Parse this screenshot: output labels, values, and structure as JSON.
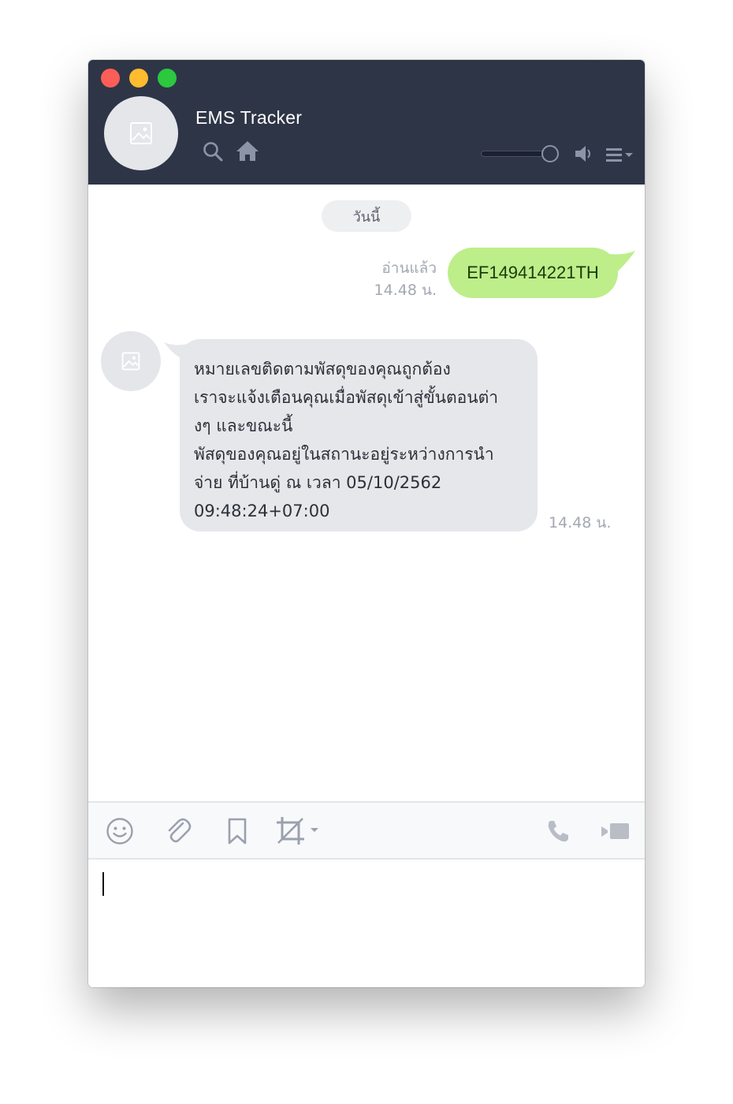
{
  "window": {
    "controls": [
      "close",
      "minimize",
      "zoom"
    ]
  },
  "header": {
    "title": "EMS Tracker",
    "avatar_icon": "image-placeholder-icon",
    "icons": [
      "search-icon",
      "home-icon",
      "speaker-icon",
      "menu-icon"
    ],
    "volume_level": 0.9,
    "colors": {
      "background": "#2e3547",
      "title": "#ffffff"
    }
  },
  "chat": {
    "date_separator": "วันนี้",
    "messages": [
      {
        "direction": "sent",
        "text": "EF149414221TH",
        "status": "อ่านแล้ว",
        "time": "14.48 น.",
        "bubble_color": "#bdee8a"
      },
      {
        "direction": "received",
        "lines": [
          "หมายเลขติดตามพัสดุของคุณถูกต้อง",
          "เราจะแจ้งเตือนคุณเมื่อพัสดุเข้าสู่ขั้นตอนต่า",
          "งๆ และขณะนี้",
          "พัสดุของคุณอยู่ในสถานะอยู่ระหว่างการนำ",
          "จ่าย ที่บ้านดู่ ณ เวลา 05/10/2562",
          "09:48:24+07:00"
        ],
        "time": "14.48 น.",
        "bubble_color": "#e5e7ea",
        "avatar_icon": "image-placeholder-icon"
      }
    ]
  },
  "toolbar": {
    "icons": [
      "emoji-icon",
      "attachment-icon",
      "bookmark-icon",
      "crop-icon",
      "phone-icon",
      "video-call-icon"
    ]
  },
  "input": {
    "value": ""
  }
}
